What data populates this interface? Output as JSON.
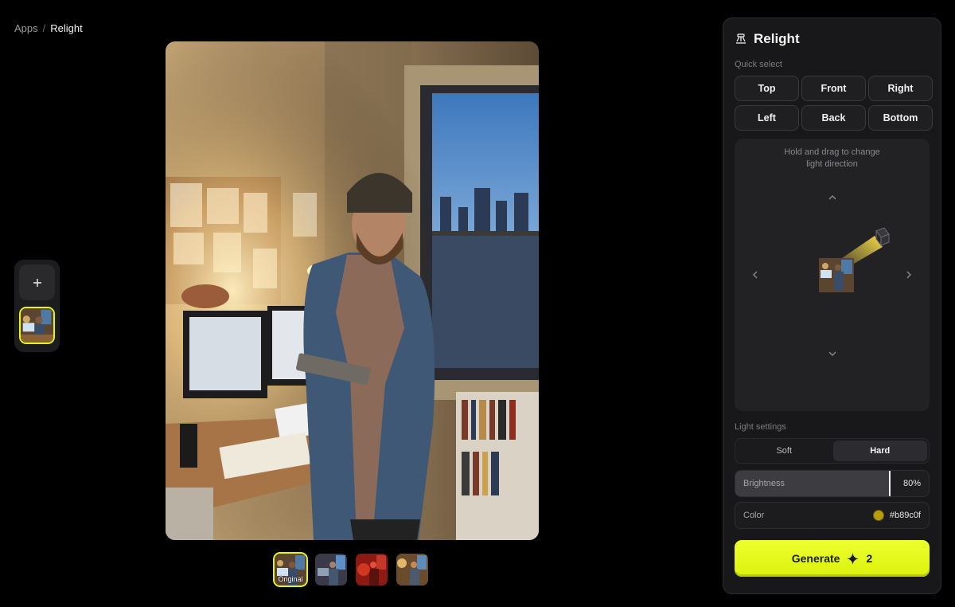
{
  "breadcrumb": {
    "root": "Apps",
    "separator": "/",
    "current": "Relight"
  },
  "rail": {
    "add_icon": "plus-icon"
  },
  "variants": {
    "items": [
      {
        "label": "Original",
        "selected": true
      },
      {
        "label": "",
        "selected": false
      },
      {
        "label": "",
        "selected": false
      },
      {
        "label": "",
        "selected": false
      }
    ]
  },
  "panel": {
    "title": "Relight",
    "icon": "spotlight-icon",
    "quick_select": {
      "label": "Quick select",
      "buttons": [
        "Top",
        "Front",
        "Right",
        "Left",
        "Back",
        "Bottom"
      ]
    },
    "drag": {
      "hint_line1": "Hold and drag to change",
      "hint_line2": "light direction"
    },
    "light_settings": {
      "label": "Light settings",
      "modes": [
        "Soft",
        "Hard"
      ],
      "active_mode": "Hard",
      "brightness_label": "Brightness",
      "brightness_value": "80%",
      "brightness_fraction": 0.8,
      "color_label": "Color",
      "color_value": "#b89c0f"
    },
    "generate": {
      "label": "Generate",
      "cost": "2",
      "icon": "sparkle-icon"
    }
  },
  "colors": {
    "accent": "#e4f51a",
    "background": "#000000",
    "panel": "#18181a"
  }
}
